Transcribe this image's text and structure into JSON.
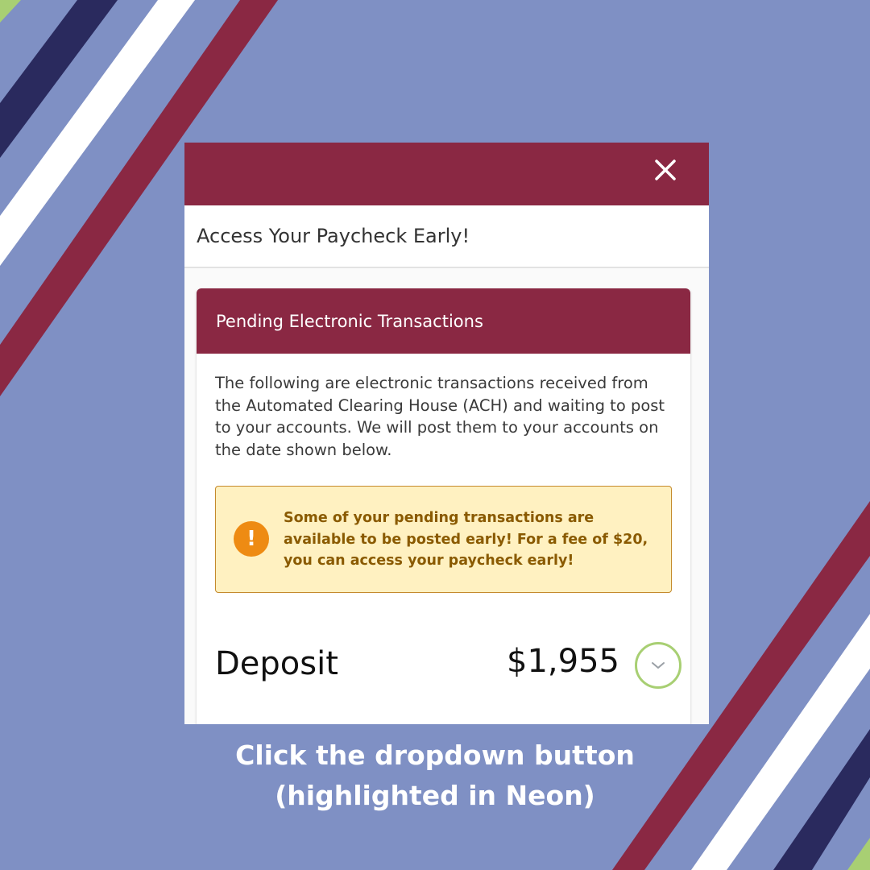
{
  "colors": {
    "background": "#7f90c4",
    "maroon": "#8a2843",
    "navy": "#2a2a5e",
    "white": "#ffffff",
    "lime": "#a8cf73",
    "alert_bg": "#fff1c1",
    "alert_text": "#8a5a00",
    "alert_icon": "#ee8b13"
  },
  "modal": {
    "close_icon": "close-icon",
    "title": "Access Your Paycheck Early!"
  },
  "card": {
    "title": "Pending Electronic Transactions",
    "description": "The following are electronic transactions received from the Automated Clearing House (ACH) and waiting to post to your accounts. We will post them to your accounts on the date shown below.",
    "alert": {
      "icon": "exclamation-icon",
      "symbol": "!",
      "text": "Some of your pending transactions are available to be posted early! For a fee of $20, you can access your paycheck early!"
    },
    "deposit": {
      "label": "Deposit",
      "amount": "$1,955",
      "dropdown_icon": "chevron-down-icon"
    }
  },
  "caption": {
    "line1": "Click the dropdown button",
    "line2": "(highlighted in Neon)"
  }
}
